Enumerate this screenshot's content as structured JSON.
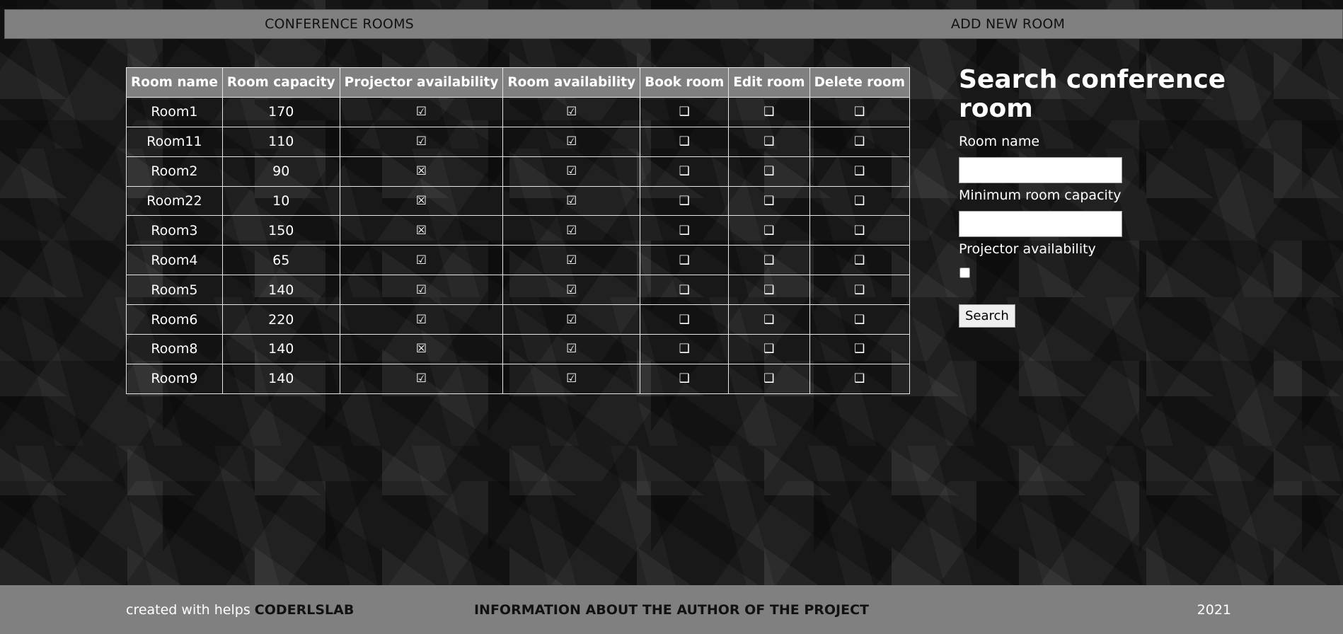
{
  "nav": {
    "rooms_label": "CONFERENCE ROOMS",
    "add_label": "ADD NEW ROOM"
  },
  "table": {
    "headers": [
      "Room name",
      "Room capacity",
      "Projector availability",
      "Room availability",
      "Book room",
      "Edit room",
      "Delete room"
    ],
    "rows": [
      {
        "name": "Room1",
        "capacity": "170",
        "projector": "☑",
        "availability": "☑",
        "book": "❑",
        "edit": "❑",
        "delete": "❑"
      },
      {
        "name": "Room11",
        "capacity": "110",
        "projector": "☑",
        "availability": "☑",
        "book": "❑",
        "edit": "❑",
        "delete": "❑"
      },
      {
        "name": "Room2",
        "capacity": "90",
        "projector": "☒",
        "availability": "☑",
        "book": "❑",
        "edit": "❑",
        "delete": "❑"
      },
      {
        "name": "Room22",
        "capacity": "10",
        "projector": "☒",
        "availability": "☑",
        "book": "❑",
        "edit": "❑",
        "delete": "❑"
      },
      {
        "name": "Room3",
        "capacity": "150",
        "projector": "☒",
        "availability": "☑",
        "book": "❑",
        "edit": "❑",
        "delete": "❑"
      },
      {
        "name": "Room4",
        "capacity": "65",
        "projector": "☑",
        "availability": "☑",
        "book": "❑",
        "edit": "❑",
        "delete": "❑"
      },
      {
        "name": "Room5",
        "capacity": "140",
        "projector": "☑",
        "availability": "☑",
        "book": "❑",
        "edit": "❑",
        "delete": "❑"
      },
      {
        "name": "Room6",
        "capacity": "220",
        "projector": "☑",
        "availability": "☑",
        "book": "❑",
        "edit": "❑",
        "delete": "❑"
      },
      {
        "name": "Room8",
        "capacity": "140",
        "projector": "☒",
        "availability": "☑",
        "book": "❑",
        "edit": "❑",
        "delete": "❑"
      },
      {
        "name": "Room9",
        "capacity": "140",
        "projector": "☑",
        "availability": "☑",
        "book": "❑",
        "edit": "❑",
        "delete": "❑"
      }
    ]
  },
  "search": {
    "title": "Search conference room",
    "room_name_label": "Room name",
    "room_name_value": "",
    "min_capacity_label": "Minimum room capacity",
    "min_capacity_value": "",
    "projector_label": "Projector availability",
    "projector_checked": false,
    "button_label": "Search"
  },
  "footer": {
    "created_prefix": "created with helps ",
    "created_brand": "CODERLSLAB",
    "author_link": "INFORMATION ABOUT THE AUTHOR OF THE PROJECT",
    "year": "2021"
  }
}
